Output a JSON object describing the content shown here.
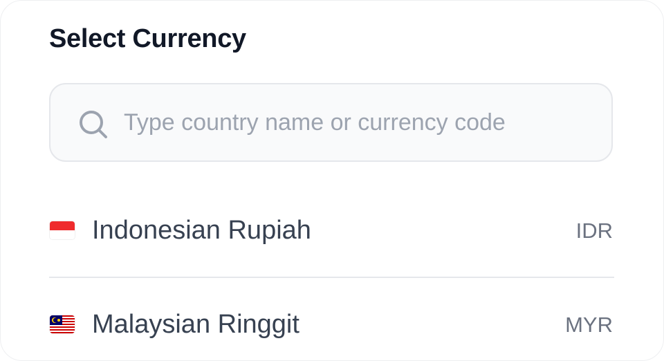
{
  "header": {
    "title": "Select Currency"
  },
  "search": {
    "placeholder": "Type country name or currency code",
    "value": ""
  },
  "currencies": [
    {
      "name": "Indonesian Rupiah",
      "code": "IDR",
      "flag_icon": "indonesia-flag-icon"
    },
    {
      "name": "Malaysian Ringgit",
      "code": "MYR",
      "flag_icon": "malaysia-flag-icon"
    }
  ],
  "colors": {
    "title": "#111827",
    "text": "#374151",
    "muted": "#6b7280",
    "placeholder": "#9ca3af",
    "border": "#e5e7eb",
    "input_bg": "#f9fafb"
  }
}
